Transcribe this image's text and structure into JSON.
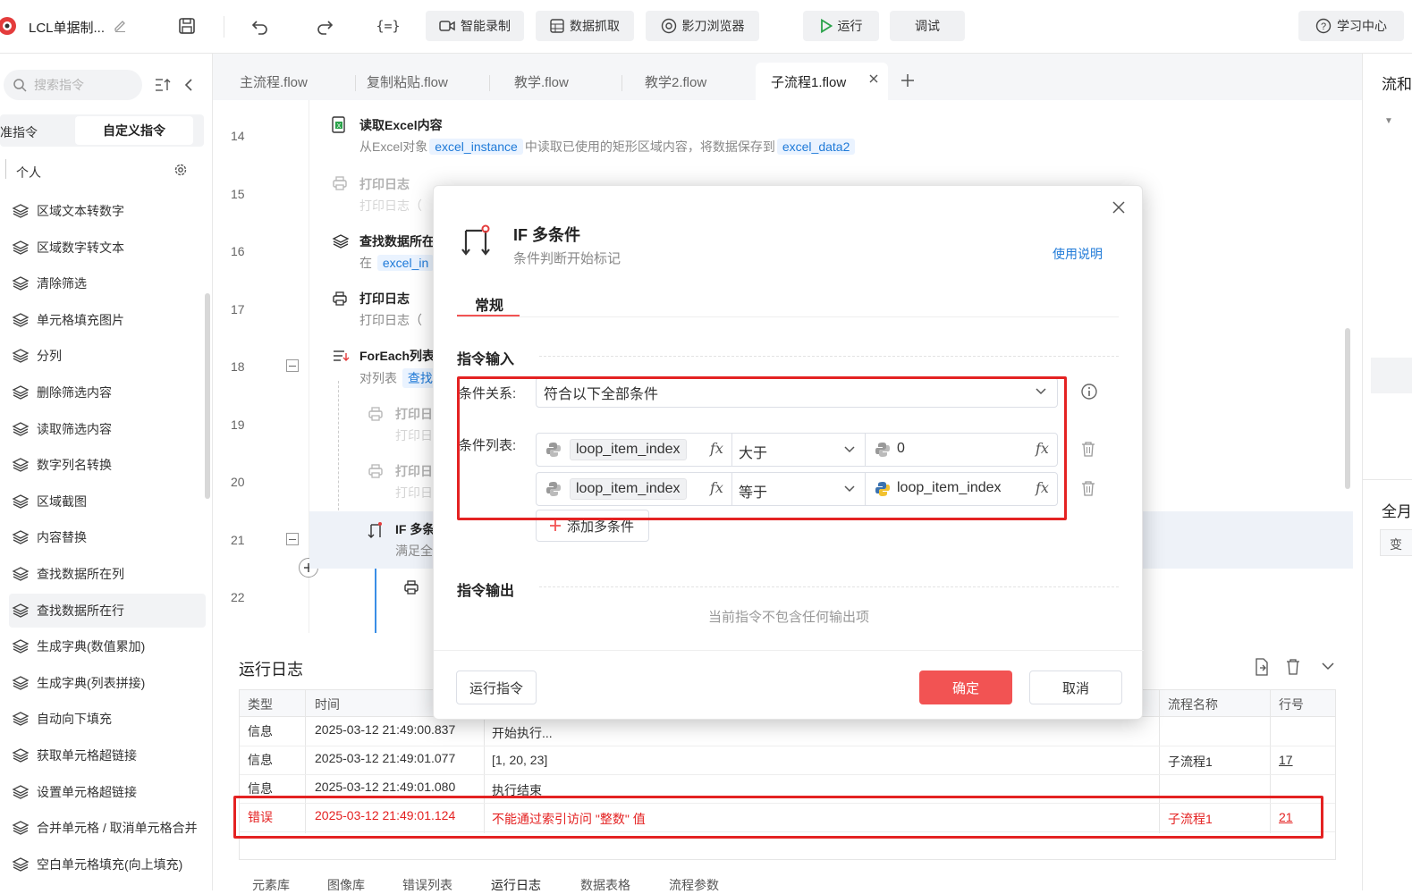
{
  "toolbar": {
    "app_title": "LCL单据制...",
    "smart_record": "智能录制",
    "data_capture": "数据抓取",
    "browser": "影刀浏览器",
    "run": "运行",
    "debug": "调试",
    "learn_center": "学习中心"
  },
  "sidebar": {
    "search_placeholder": "搜索指令",
    "tab_standard": "准指令",
    "tab_custom": "自定义指令",
    "group": "个人",
    "items": [
      "区域文本转数字",
      "区域数字转文本",
      "清除筛选",
      "单元格填充图片",
      "分列",
      "删除筛选内容",
      "读取筛选内容",
      "数字列名转换",
      "区域截图",
      "内容替换",
      "查找数据所在列",
      "查找数据所在行",
      "生成字典(数值累加)",
      "生成字典(列表拼接)",
      "自动向下填充",
      "获取单元格超链接",
      "设置单元格超链接",
      "合并单元格 / 取消单元格合并",
      "空白单元格填充(向上填充)"
    ],
    "active_index": 11
  },
  "tabs": [
    "主流程.flow",
    "复制粘贴.flow",
    "教学.flow",
    "教学2.flow",
    "子流程1.flow"
  ],
  "active_tab": 4,
  "flow": {
    "line_numbers": [
      "14",
      "15",
      "16",
      "17",
      "18",
      "19",
      "20",
      "21",
      "22"
    ],
    "steps": {
      "s14_title": "读取Excel内容",
      "s14_desc_a": "从Excel对象",
      "s14_var1": "excel_instance",
      "s14_desc_b": "中读取已使用的矩形区域内容，将数据保存到",
      "s14_var2": "excel_data2",
      "s15_title": "打印日志",
      "s15_desc": "打印日志（",
      "s16_title": "查找数据所在",
      "s16_desc": "在",
      "s16_var": "excel_in",
      "s17_title": "打印日志",
      "s17_desc": "打印日志（",
      "s18_title": "ForEach列表",
      "s18_desc": "对列表",
      "s18_var": "查找",
      "s19_title": "打印日",
      "s19_desc": "打印日",
      "s20_title": "打印日",
      "s20_desc": "打印日",
      "s21_title": "IF 多条",
      "s21_desc": "满足全"
    }
  },
  "log": {
    "title": "运行日志",
    "headers": [
      "类型",
      "时间",
      "",
      "流程名称",
      "行号"
    ],
    "rows": [
      {
        "type": "信息",
        "time": "2025-03-12 21:49:00.837",
        "msg": "开始执行...",
        "flow": "",
        "line": ""
      },
      {
        "type": "信息",
        "time": "2025-03-12 21:49:01.077",
        "msg": "[1, 20, 23]",
        "flow": "子流程1",
        "line": "17"
      },
      {
        "type": "信息",
        "time": "2025-03-12 21:49:01.080",
        "msg": "执行结束",
        "flow": "",
        "line": ""
      },
      {
        "type": "错误",
        "time": "2025-03-12 21:49:01.124",
        "msg": "不能通过索引访问 \"整数\" 值",
        "flow": "子流程1",
        "line": "21"
      }
    ],
    "bottom_tabs": [
      "元素库",
      "图像库",
      "错误列表",
      "运行日志",
      "数据表格",
      "流程参数"
    ]
  },
  "modal": {
    "title": "IF 多条件",
    "subtitle": "条件判断开始标记",
    "help_link": "使用说明",
    "tab": "常规",
    "section_input": "指令输入",
    "relation_label": "条件关系:",
    "relation_value": "符合以下全部条件",
    "list_label": "条件列表:",
    "conditions": [
      {
        "left": "loop_item_index",
        "op": "大于",
        "right": "0"
      },
      {
        "left": "loop_item_index",
        "op": "等于",
        "right": "loop_item_index"
      }
    ],
    "add_condition": "添加多条件",
    "section_output": "指令输出",
    "no_output": "当前指令不包含任何输出项",
    "run_cmd": "运行指令",
    "confirm": "确定",
    "cancel": "取消"
  },
  "right_panel": {
    "title_a": "流和",
    "title_b": "全月",
    "col": "变"
  },
  "colors": {
    "accent_red": "#f25353",
    "link_blue": "#1f7ad8",
    "error_red": "#e42222"
  }
}
